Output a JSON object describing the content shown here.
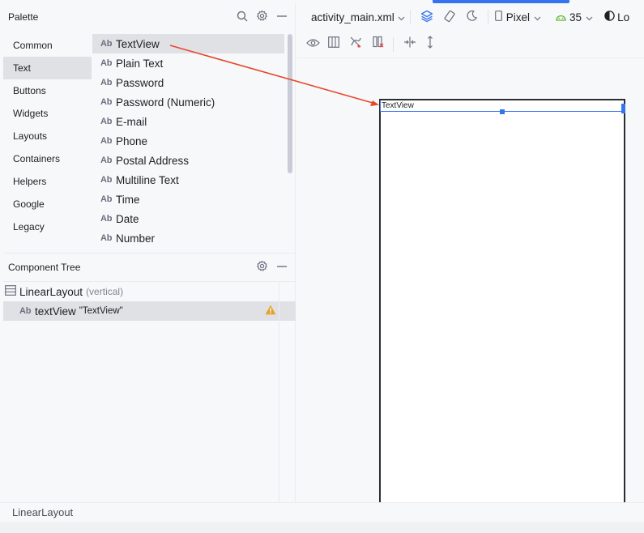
{
  "palette": {
    "title": "Palette",
    "categories": [
      "Common",
      "Text",
      "Buttons",
      "Widgets",
      "Layouts",
      "Containers",
      "Helpers",
      "Google",
      "Legacy"
    ],
    "selected_category": 1,
    "items": [
      "TextView",
      "Plain Text",
      "Password",
      "Password (Numeric)",
      "E-mail",
      "Phone",
      "Postal Address",
      "Multiline Text",
      "Time",
      "Date",
      "Number"
    ],
    "item_prefix": "Ab",
    "selected_item": 0
  },
  "component_tree": {
    "title": "Component Tree",
    "root": {
      "label": "LinearLayout",
      "detail": "(vertical)"
    },
    "child": {
      "prefix": "Ab",
      "label": "textView",
      "detail": "\"TextView\""
    }
  },
  "toolbar": {
    "file": "activity_main.xml",
    "device": "Pixel",
    "api": "35",
    "locale_partial": "Lo"
  },
  "canvas": {
    "textview_label": "TextView"
  },
  "statusbar": {
    "breadcrumb": "LinearLayout"
  },
  "colors": {
    "accent": "#3574f0",
    "arrow": "#e8472a",
    "warning": "#e5a229",
    "android_green": "#5fb832"
  }
}
